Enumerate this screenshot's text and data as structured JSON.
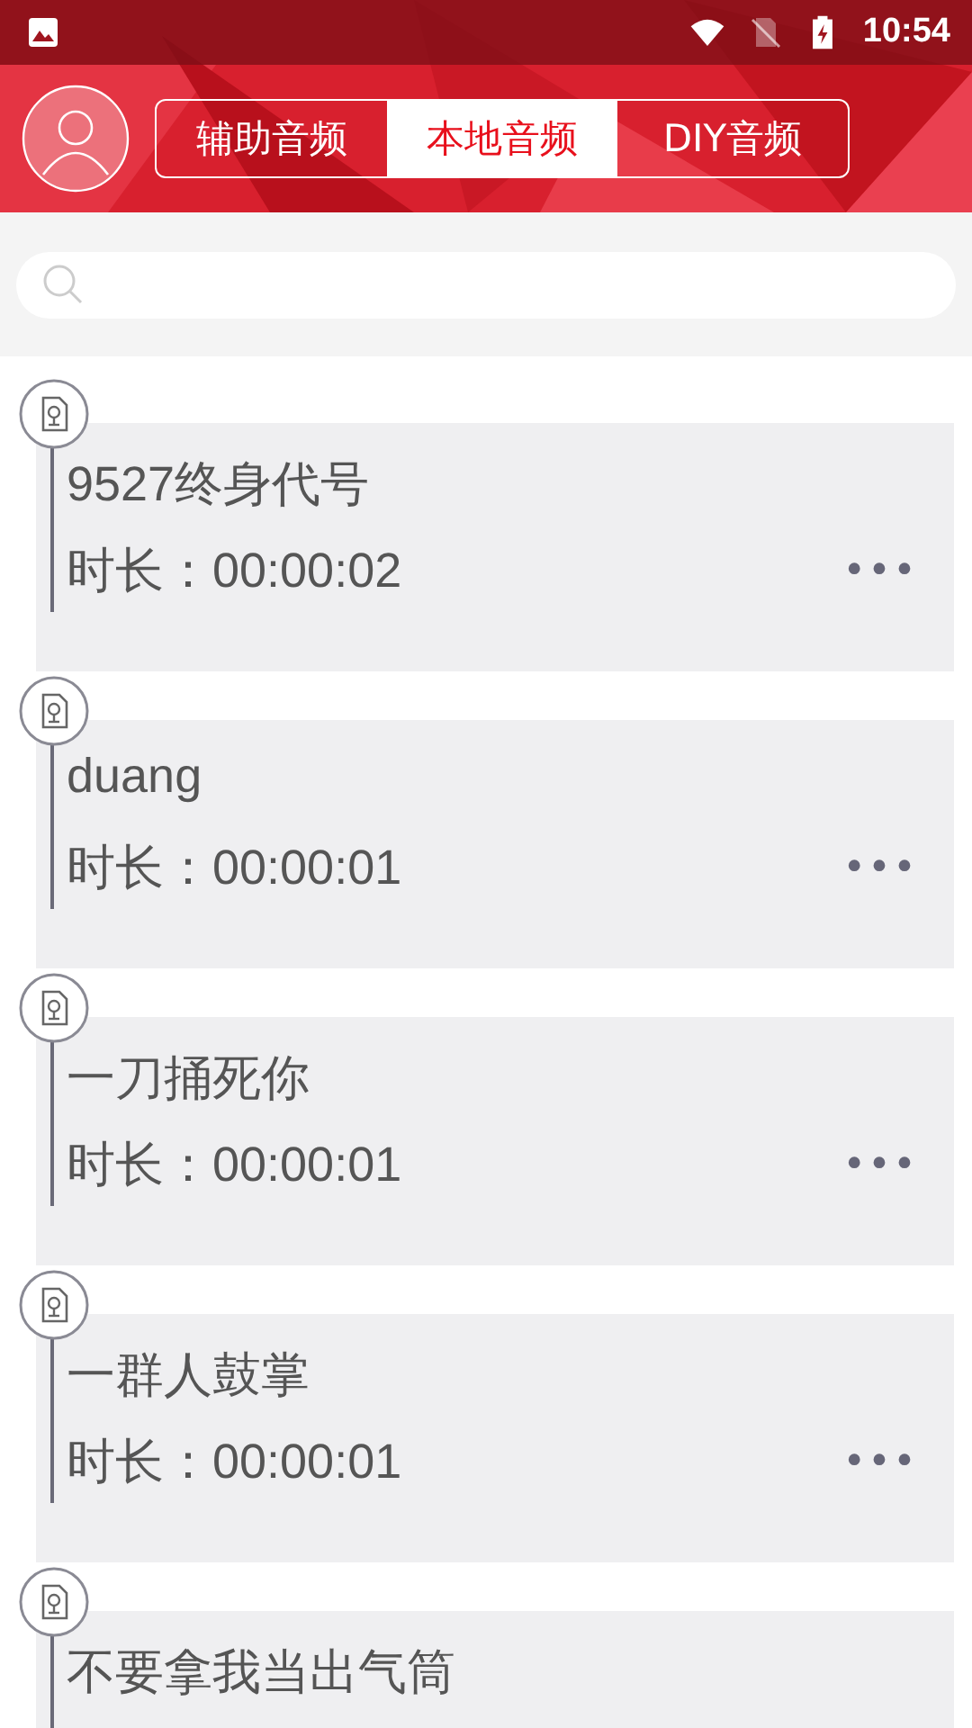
{
  "status_bar": {
    "time": "10:54"
  },
  "tabs": [
    {
      "label": "辅助音频",
      "selected": false
    },
    {
      "label": "本地音频",
      "selected": true
    },
    {
      "label": "DIY音频",
      "selected": false
    }
  ],
  "items": [
    {
      "title": "9527终身代号",
      "duration": "时长：00:00:02",
      "more": "•••"
    },
    {
      "title": "duang",
      "duration": "时长：00:00:01",
      "more": "•••"
    },
    {
      "title": "一刀捅死你",
      "duration": "时长：00:00:01",
      "more": "•••"
    },
    {
      "title": "一群人鼓掌",
      "duration": "时长：00:00:01",
      "more": "•••"
    },
    {
      "title": "不要拿我当出气筒"
    }
  ]
}
